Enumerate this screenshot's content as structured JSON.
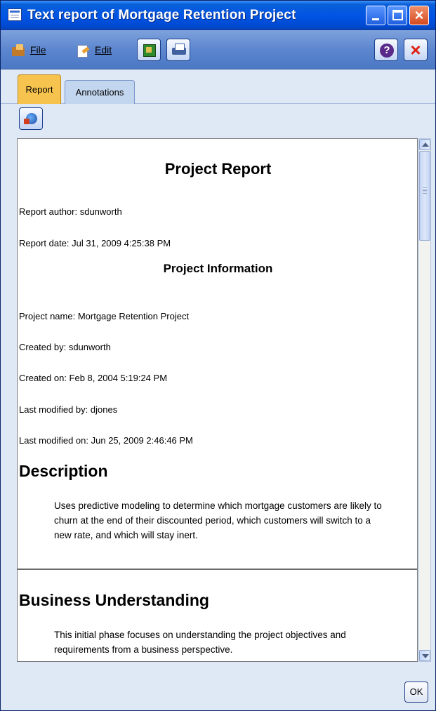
{
  "window": {
    "title": "Text report of Mortgage Retention Project"
  },
  "menu": {
    "file_label": "File",
    "edit_label": "Edit"
  },
  "tabs": [
    {
      "label": "Report",
      "active": true
    },
    {
      "label": "Annotations",
      "active": false
    }
  ],
  "report": {
    "title": "Project Report",
    "author": "Report author: sdunworth",
    "date": "Report date: Jul 31, 2009 4:25:38 PM",
    "section_info_title": "Project Information",
    "project_name": "Project name: Mortgage Retention Project",
    "created_by": "Created by: sdunworth",
    "created_on": "Created on: Feb 8, 2004 5:19:24 PM",
    "last_modified_by": "Last modified by: djones",
    "last_modified_on": "Last modified on: Jun 25, 2009 2:46:46 PM",
    "description_heading": "Description",
    "description_text": "Uses predictive modeling to determine which mortgage customers are likely to churn at the end of their discounted period, which customers will switch to a new rate, and which will stay inert.",
    "business_heading": "Business Understanding",
    "business_text": "This initial phase focuses on understanding the project objectives and requirements from a business perspective."
  },
  "buttons": {
    "ok_label": "OK"
  },
  "colors": {
    "titlebar": "#0055e5",
    "toolbar": "#5c86cf",
    "active_tab": "#f6c44e",
    "window_bg": "#dfe9f5"
  },
  "icons": {
    "window": "report-window-icon",
    "file": "folder-icon",
    "edit": "edit-page-icon",
    "export": "export-icon",
    "print": "print-icon",
    "help": "help-icon",
    "close": "close-icon",
    "globe": "globe-publish-icon"
  }
}
